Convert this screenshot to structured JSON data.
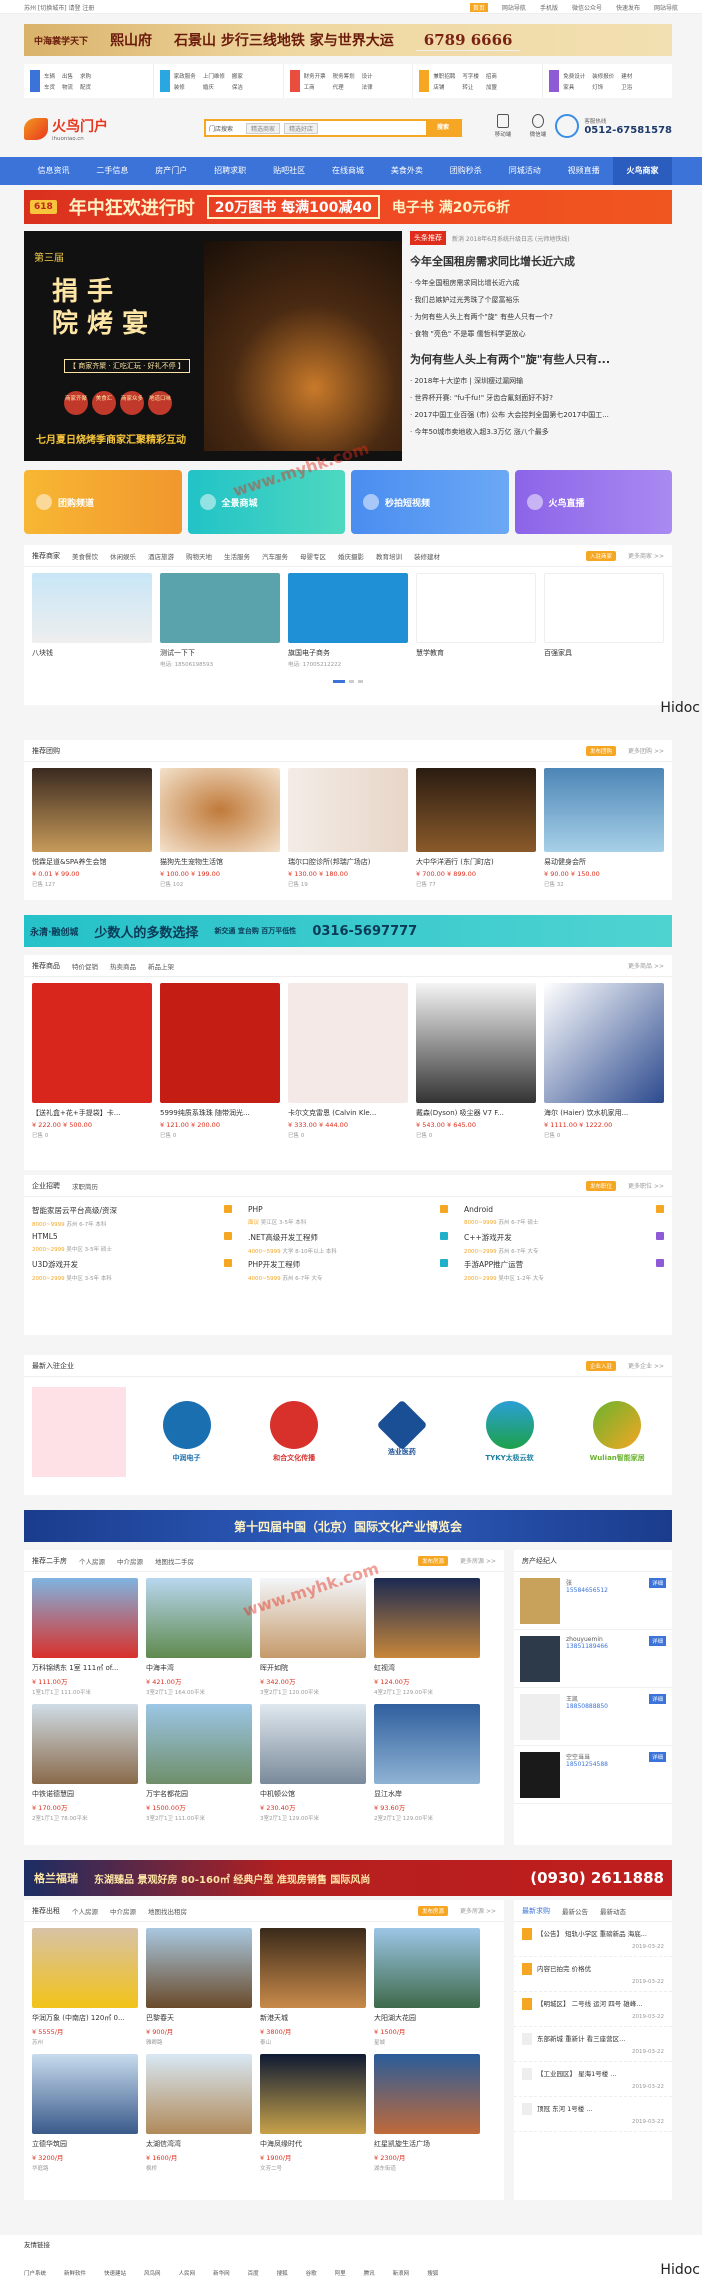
{
  "topbar": {
    "left": "苏州 [切换城市]    请登 注册",
    "right": [
      "首页",
      "网站导航",
      "手机版",
      "微信公众号",
      "快速发布",
      "网站导航"
    ]
  },
  "banner_top": {
    "brand": "中海裳学天下",
    "estate": "熙山府",
    "slogan": "石景山 步行三线地铁 家与世界大运",
    "phone": "6789 6666"
  },
  "quick_links": [
    [
      "车辆",
      "出售",
      "求购",
      "车货",
      "物流",
      "配货"
    ],
    [
      "家政服务",
      "上门维修",
      "搬家",
      "装修",
      "婚庆",
      "保洁"
    ],
    [
      "财务开票",
      "税务筹划",
      "设计",
      "工商",
      "代理",
      "法律"
    ],
    [
      "兼职招聘",
      "写字楼",
      "招商",
      "店铺",
      "转让",
      "加盟"
    ],
    [
      "免费设计",
      "装修报价",
      "建材",
      "家具",
      "灯饰",
      "卫浴"
    ]
  ],
  "header": {
    "logo_name": "火鸟门户",
    "logo_domain": "ihuoniao.cn",
    "search_select": "门店搜索",
    "search_tags": [
      "精选商家",
      "精选好店"
    ],
    "search_btn": "搜索",
    "icons": [
      "移动端",
      "微信端"
    ],
    "hotline_label": "客服热线",
    "hotline": "0512-67581578"
  },
  "nav": [
    "信息资讯",
    "二手信息",
    "房产门户",
    "招聘求职",
    "贴吧社区",
    "在线商城",
    "美食外卖",
    "团购秒杀",
    "同城活动",
    "视频直播",
    "火鸟商家"
  ],
  "promo": {
    "tag": "618",
    "title": "年中狂欢进行时",
    "offer": "20万图书 每满100减40",
    "coupon": "电子书 满20元6折"
  },
  "hero": {
    "edition": "第三届",
    "title_a": "捐 手",
    "title_b": "院 烤 宴",
    "tags": "【 商家齐聚 · 汇吃汇玩 · 好礼不停 】",
    "circles": [
      "商家齐聚",
      "美食汇",
      "商家众多",
      "地道口味"
    ],
    "caption": "七月夏日烧烤季商家汇聚精彩互动"
  },
  "news": {
    "label": "头条推荐",
    "meta": "新消 2018年6月系统升级日志 (元师地铁线)",
    "headline1": "今年全国租房需求同比增长近六成",
    "items1": [
      "今年全国租房需求同比增长近六成",
      "我们总嫉妒过光秀珠了个屋富裕乐",
      "为何有些人头上有两个\"旋\" 有些人只有一个?",
      "食物 \"亮色\" 不是罪 儒哲科学更放心"
    ],
    "headline2": "为何有些人头上有两个\"旋\"有些人只有...",
    "items2": [
      "2018年十大逆市 | 深圳瘦过漏网输",
      "世界杯开赛: \"fu千fu!\" 牙齿合氟刻面好不好?",
      "2017中国工业百强 (市) 公布 大会控判全国第七2017中国工...",
      "今年50城市卖地收入超3.3万亿 涨八个最多"
    ]
  },
  "tiles": [
    "团购频道",
    "全景商城",
    "秒拍短视频",
    "火鸟直播"
  ],
  "business": {
    "tabs": [
      "推荐商家",
      "美食餐饮",
      "休闲娱乐",
      "酒店旅游",
      "购物天地",
      "生活服务",
      "汽车服务",
      "母婴专区",
      "婚庆摄影",
      "教育培训",
      "装修建材"
    ],
    "btn": "入驻商家",
    "more": "更多商家 >>",
    "cards": [
      {
        "name": "八块钱",
        "sub": ""
      },
      {
        "name": "测试一下下",
        "sub": "电话: 18506198593"
      },
      {
        "name": "旗国电子商务",
        "sub": "电话: 17005212222"
      },
      {
        "name": "慧学教育",
        "sub": ""
      },
      {
        "name": "百强家具",
        "sub": ""
      }
    ]
  },
  "groupbuy": {
    "title": "推荐团购",
    "btn": "发布团购",
    "more": "更多团购 >>",
    "cards": [
      {
        "name": "悦霖足道&SPA养生会馆",
        "price": "¥ 0.01 ¥ 99.00",
        "sold": "已售 127"
      },
      {
        "name": "猫狗先生宠物生活馆",
        "price": "¥ 100.00 ¥ 199.00",
        "sold": "已售 102"
      },
      {
        "name": "瑞尔口腔诊所(邦瑞广场店)",
        "price": "¥ 130.00 ¥ 180.00",
        "sold": "已售 19"
      },
      {
        "name": "大中华洋酒行 (东门町店)",
        "price": "¥ 700.00 ¥ 899.00",
        "sold": "已售 77"
      },
      {
        "name": "易动健身会所",
        "price": "¥ 90.00 ¥ 150.00",
        "sold": "已售 32"
      }
    ]
  },
  "ad_cyan": {
    "brand": "永清·融创城",
    "slogan": "少数人的多数选择",
    "tags": "新交通 宜台购 百万平低性",
    "phone": "0316-5697777"
  },
  "shop": {
    "tabs": [
      "推荐商品",
      "特价促销",
      "热卖商品",
      "新品上架"
    ],
    "more": "更多商品 >>",
    "cards": [
      {
        "name": "【送礼盒+花+手提袋】卡...",
        "price": "¥ 222.00 ¥ 500.00",
        "sold": "已售 0"
      },
      {
        "name": "5999纯质系珠珠 随带润光...",
        "price": "¥ 121.00 ¥ 200.00",
        "sold": "已售 0"
      },
      {
        "name": "卡尔文克雷恩 (Calvin Kle...",
        "price": "¥ 333.00 ¥ 444.00",
        "sold": "已售 0"
      },
      {
        "name": "戴森(Dyson) 吸尘器 V7 F...",
        "price": "¥ 543.00 ¥ 645.00",
        "sold": "已售 0"
      },
      {
        "name": "海尔 (Haier) 饮水机家用...",
        "price": "¥ 1111.00 ¥ 1222.00",
        "sold": "已售 0"
      }
    ]
  },
  "jobs": {
    "tabs": [
      "企业招聘",
      "求职简历"
    ],
    "btn": "发布职位",
    "more": "更多职位 >>",
    "items": [
      {
        "title": "智能家居云平台高级/资深",
        "salary": "8000~9999",
        "meta": "苏州 6-7年 本科"
      },
      {
        "title": "PHP",
        "salary": "面议",
        "meta": "吴江区 3-5年 本科"
      },
      {
        "title": "Android",
        "salary": "8000~9999",
        "meta": "苏州 6-7年 硕士"
      },
      {
        "title": "HTML5",
        "salary": "2000~2999",
        "meta": "吴中区 3-5年 硕士"
      },
      {
        "title": ".NET高级开发工程师",
        "salary": "4000~5999",
        "meta": "大学 8-10年以上 本科"
      },
      {
        "title": "C++游戏开发",
        "salary": "2000~2999",
        "meta": "苏州 6-7年 大专"
      },
      {
        "title": "U3D游戏开发",
        "salary": "2000~2999",
        "meta": "吴中区 3-5年 本科"
      },
      {
        "title": "PHP开发工程师",
        "salary": "4000~5999",
        "meta": "苏州 6-7年 大专"
      },
      {
        "title": "手游APP推广运营",
        "salary": "2000~2999",
        "meta": "吴中区 1-2年 大专"
      }
    ]
  },
  "companies": {
    "title": "最新入驻企业",
    "btn": "企业入驻",
    "more": "更多企业 >>",
    "items": [
      {
        "name": "",
        "color": "#fde1e6"
      },
      {
        "name": "中润电子",
        "color": "#1a6fb0"
      },
      {
        "name": "和合文化传播",
        "color": "#d8302b"
      },
      {
        "name": "浩业医药",
        "color": "#1a4f96"
      },
      {
        "name": "TYKY太极云软",
        "color": "#1ea14a"
      },
      {
        "name": "Wulian智能家居",
        "color": "#6ab32e"
      }
    ]
  },
  "ad_blue": {
    "text": "第十四届中国（北京）国际文化产业博览会"
  },
  "house": {
    "tabs": [
      "推荐二手房",
      "个人房源",
      "中介房源",
      "地图找二手房"
    ],
    "btn": "发布房源",
    "more": "更多房源 >>",
    "cards": [
      {
        "name": "万科锦绣东 1室 111㎡ of...",
        "price": "¥ 111.00万",
        "sub": "1室1厅1卫 111.00平米"
      },
      {
        "name": "中海丰湾",
        "price": "¥ 421.00万",
        "sub": "3室2厅1卫 164.00平米"
      },
      {
        "name": "晖开如院",
        "price": "¥ 342.00万",
        "sub": "3室2厅1卫 120.00平米"
      },
      {
        "name": "虹视湾",
        "price": "¥ 124.00万",
        "sub": "4室2厅1卫 129.00平米"
      },
      {
        "name": "中铁诺德慧园",
        "price": "¥ 170.00万",
        "sub": "2室1厅1卫 78.00平米"
      },
      {
        "name": "万宇名都花园",
        "price": "¥ 1500.00万",
        "sub": "3室2厅1卫 111.00平米"
      },
      {
        "name": "中机顿公馆",
        "price": "¥ 230.40万",
        "sub": "3室2厅1卫 129.00平米"
      },
      {
        "name": "显江水岸",
        "price": "¥ 93.60万",
        "sub": "2室2厅1卫 129.00平米"
      }
    ]
  },
  "agents": {
    "title": "房产经纪人",
    "detail": "详细",
    "items": [
      {
        "name": "张",
        "phone": "15584656512"
      },
      {
        "name": "zhouyuemin",
        "phone": "13851189466"
      },
      {
        "name": "王凯",
        "phone": "18850888850"
      },
      {
        "name": "空空当当",
        "phone": "18501254588"
      }
    ]
  },
  "ad_red": {
    "brand": "格兰福瑞",
    "text": "东湖臻品 景观好房 80-160㎡ 经典户型 准现房销售 国际风尚",
    "phone": "(0930) 2611888"
  },
  "rent": {
    "tabs": [
      "推荐出租",
      "个人房源",
      "中介房源",
      "地图找出租房"
    ],
    "btn": "发布房源",
    "more": "更多房源 >>",
    "cards": [
      {
        "name": "华润万象 (中南店) 120㎡ 0...",
        "price": "¥ 5555/月",
        "sub": "苏州"
      },
      {
        "name": "巴黎春天",
        "price": "¥ 900/月",
        "sub": "雅卿路"
      },
      {
        "name": "新港天城",
        "price": "¥ 3800/月",
        "sub": "泰山"
      },
      {
        "name": "大阳湖大花园",
        "price": "¥ 1500/月",
        "sub": "星城"
      },
      {
        "name": "立德华筑园",
        "price": "¥ 3200/月",
        "sub": "华庭路"
      },
      {
        "name": "太湖信湾湾",
        "price": "¥ 1600/月",
        "sub": "枫桥"
      },
      {
        "name": "中海凤缘时代",
        "price": "¥ 1900/月",
        "sub": "文芳二号"
      },
      {
        "name": "红星凯旋生活广场",
        "price": "¥ 2300/月",
        "sub": "湖东街道"
      }
    ]
  },
  "notices": {
    "tabs": [
      "最新求购",
      "最新公告",
      "最新动态"
    ],
    "items": [
      {
        "text": "【公告】 短轨小学区 重磅新品 海底...",
        "date": "2019-03-22"
      },
      {
        "text": "内容已拍完 价格优",
        "date": "2019-03-22"
      },
      {
        "text": "【明城区】 二号线 运河 四号 雄峰...",
        "date": "2019-03-22"
      },
      {
        "text": "东部新城 重新计 看三座营区...",
        "date": "2019-03-22"
      },
      {
        "text": "【工业园区】 星海1号楼 ...",
        "date": "2019-03-22"
      },
      {
        "text": "顶冠 东河 1号楼 ...",
        "date": "2019-03-22"
      }
    ]
  },
  "footer": {
    "title": "友情链接",
    "links": [
      "门户系统",
      "新鲜软件",
      "快速建站",
      "风鸟网",
      "人民网",
      "新华网",
      "百度",
      "搜狐",
      "谷歌",
      "阿里",
      "腾讯",
      "新浪网",
      "搜狐"
    ]
  },
  "watermark": "www.myhk.com",
  "side_mark": "Hidoc"
}
